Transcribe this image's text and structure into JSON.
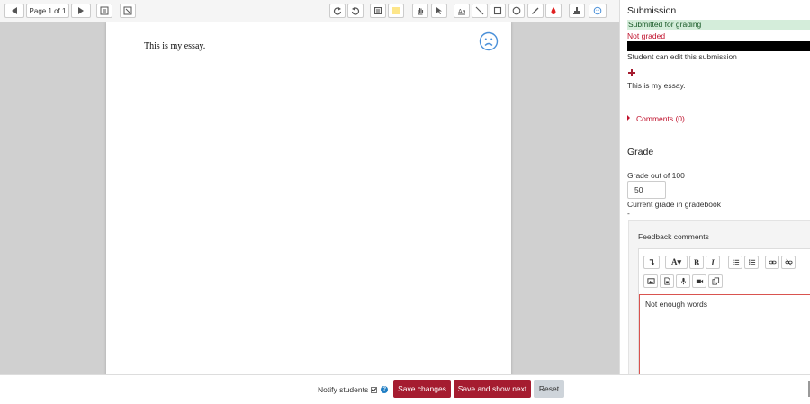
{
  "toolbar": {
    "page_label": "Page 1 of 1",
    "icons": [
      "prev-page-icon",
      "next-page-icon",
      "search-comments-icon",
      "expand-icon",
      "rotate-left-icon",
      "rotate-right-icon",
      "comment-icon",
      "comment-color-icon",
      "pan-icon",
      "select-icon",
      "text-annotation-icon",
      "line-icon",
      "rectangle-icon",
      "oval-icon",
      "pen-icon",
      "highlight-icon",
      "stamp-icon",
      "stamp-picker-icon"
    ]
  },
  "document": {
    "text": "This is my essay.",
    "stamp_icon": "sad-face-icon"
  },
  "submission": {
    "heading": "Submission",
    "status": "Submitted for grading",
    "grading_status": "Not graded",
    "edit_status": "Student can edit this submission",
    "essay_text": "This is my essay.",
    "comments_label": "Comments (0)"
  },
  "grade": {
    "heading": "Grade",
    "grade_out_of": "Grade out of 100",
    "grade_value": "50",
    "current_grade_label": "Current grade in gradebook",
    "current_grade_value": "-"
  },
  "feedback": {
    "label": "Feedback comments",
    "editor_text": "Not enough words",
    "format_label": "A▾",
    "bold_label": "B",
    "italic_label": "I"
  },
  "footer": {
    "notify_label": "Notify students",
    "save_label": "Save changes",
    "save_next_label": "Save and show next",
    "reset_label": "Reset"
  },
  "colors": {
    "accent_red": "#a51c30",
    "success_bg": "#d4edda",
    "error_text": "#c0112c",
    "icon_blue": "#4a90d9"
  }
}
